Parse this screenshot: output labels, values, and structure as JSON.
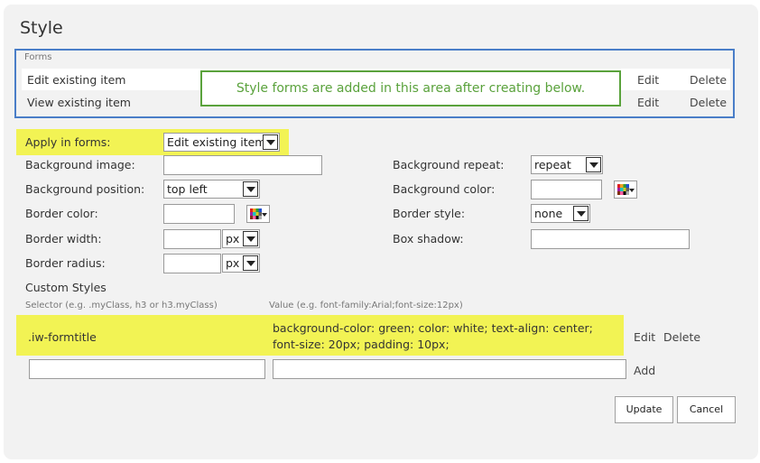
{
  "title": "Style",
  "forms": {
    "caption": "Forms",
    "rows": [
      {
        "label": "Edit existing item",
        "edit": "Edit",
        "delete": "Delete"
      },
      {
        "label": "View existing item",
        "edit": "Edit",
        "delete": "Delete"
      }
    ],
    "callout": "Style forms are added in this area after creating below."
  },
  "apply": {
    "label": "Apply in forms:",
    "value": "Edit existing item"
  },
  "fields": {
    "background_image": "Background image:",
    "background_position": {
      "label": "Background position:",
      "value": "top left"
    },
    "border_color": "Border color:",
    "border_width": {
      "label": "Border width:",
      "unit": "px"
    },
    "border_radius": {
      "label": "Border radius:",
      "unit": "px"
    },
    "background_repeat": {
      "label": "Background repeat:",
      "value": "repeat"
    },
    "background_color": "Background color:",
    "border_style": {
      "label": "Border style:",
      "value": "none"
    },
    "box_shadow": "Box shadow:"
  },
  "custom": {
    "heading": "Custom Styles",
    "selector_hint": "Selector (e.g. .myClass, h3 or h3.myClass)",
    "value_hint": "Value (e.g. font-family:Arial;font-size:12px)",
    "rows": [
      {
        "selector": ".iw-formtitle",
        "value": "background-color: green; color: white; text-align: center; font-size: 20px; padding: 10px;",
        "edit": "Edit",
        "delete": "Delete"
      }
    ],
    "add": "Add"
  },
  "buttons": {
    "update": "Update",
    "cancel": "Cancel"
  }
}
